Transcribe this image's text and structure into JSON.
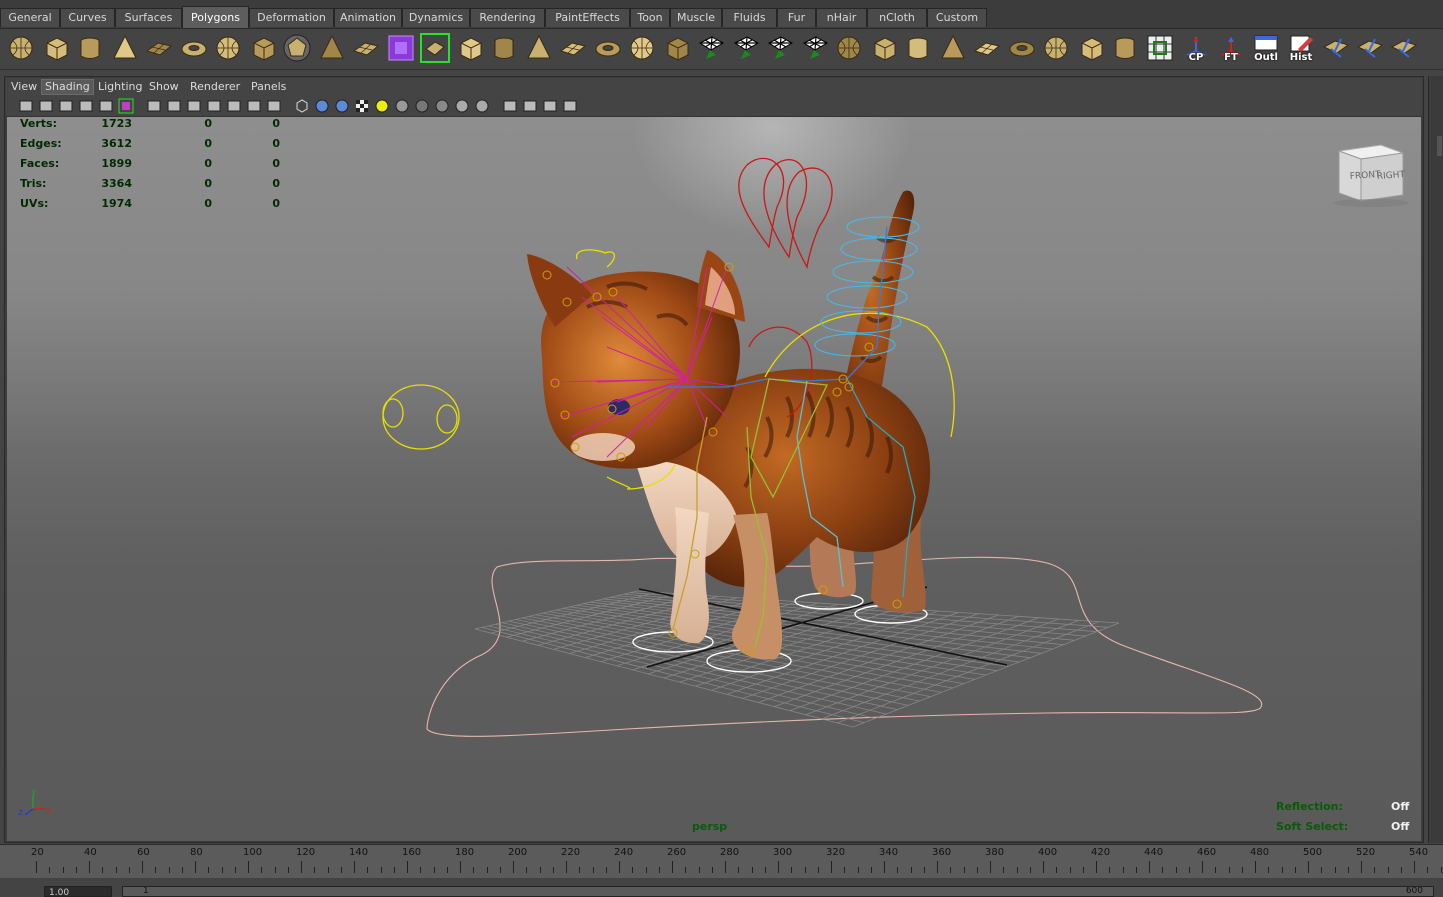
{
  "shelf_tabs": [
    {
      "label": "General",
      "active": false
    },
    {
      "label": "Curves",
      "active": false
    },
    {
      "label": "Surfaces",
      "active": false
    },
    {
      "label": "Polygons",
      "active": true
    },
    {
      "label": "Deformation",
      "active": false
    },
    {
      "label": "Animation",
      "active": false
    },
    {
      "label": "Dynamics",
      "active": false
    },
    {
      "label": "Rendering",
      "active": false
    },
    {
      "label": "PaintEffects",
      "active": false
    },
    {
      "label": "Toon",
      "active": false
    },
    {
      "label": "Muscle",
      "active": false
    },
    {
      "label": "Fluids",
      "active": false
    },
    {
      "label": "Fur",
      "active": false
    },
    {
      "label": "nHair",
      "active": false
    },
    {
      "label": "nCloth",
      "active": false
    },
    {
      "label": "Custom",
      "active": false
    }
  ],
  "shelf_buttons": [
    {
      "icon": "poly-sphere-icon"
    },
    {
      "icon": "poly-cube-icon"
    },
    {
      "icon": "poly-cylinder-icon"
    },
    {
      "icon": "poly-cone-icon"
    },
    {
      "icon": "poly-plane-icon"
    },
    {
      "icon": "poly-torus-icon"
    },
    {
      "icon": "poly-pyramid-icon"
    },
    {
      "icon": "poly-pipe-icon"
    },
    {
      "icon": "poly-platonic-icon"
    },
    {
      "icon": "combine-icon"
    },
    {
      "icon": "separate-icon"
    },
    {
      "icon": "smooth-icon"
    },
    {
      "icon": "extract-icon"
    },
    {
      "icon": "mirror-geometry-icon"
    },
    {
      "icon": "bridge-icon"
    },
    {
      "icon": "append-polygon-icon"
    },
    {
      "icon": "split-polygon-icon"
    },
    {
      "icon": "insert-edge-loop-icon"
    },
    {
      "icon": "extrude-icon"
    },
    {
      "icon": "merge-icon"
    },
    {
      "icon": "fill-hole-icon"
    },
    {
      "icon": "bevel-icon"
    },
    {
      "icon": "collapse-icon"
    },
    {
      "icon": "duplicate-face-icon"
    },
    {
      "icon": "wedge-icon"
    },
    {
      "icon": "poke-icon"
    },
    {
      "icon": "chamfer-icon"
    },
    {
      "icon": "offset-edge-icon"
    },
    {
      "icon": "sculpt-icon"
    },
    {
      "icon": "planar-map-icon"
    },
    {
      "icon": "cylindrical-map-icon"
    },
    {
      "icon": "spherical-map-icon"
    },
    {
      "icon": "automatic-map-icon"
    },
    {
      "icon": "uv-editor-icon"
    }
  ],
  "shelf_text_buttons": [
    {
      "icon": "center-pivot-icon",
      "label": "CP"
    },
    {
      "icon": "freeze-transform-icon",
      "label": "FT"
    },
    {
      "icon": "outliner-icon",
      "label": "Outl"
    },
    {
      "icon": "history-icon",
      "label": "Hist"
    }
  ],
  "shelf_tail_buttons": [
    {
      "icon": "poly-tool-a-icon"
    },
    {
      "icon": "poly-tool-b-icon"
    },
    {
      "icon": "poly-tool-c-icon"
    }
  ],
  "panel_menu": [
    {
      "label": "View",
      "active": false
    },
    {
      "label": "Shading",
      "active": true
    },
    {
      "label": "Lighting",
      "active": false
    },
    {
      "label": "Show",
      "active": false
    },
    {
      "label": "Renderer",
      "active": false
    },
    {
      "label": "Panels",
      "active": false
    }
  ],
  "panel_toolbar": [
    "select-camera-icon",
    "camera-attributes-icon",
    "bookmark-icon",
    "image-plane-icon",
    "two-d-pan-icon",
    "frame-icon",
    "grid-icon",
    "film-gate-icon",
    "resolution-gate-icon",
    "gate-mask-icon",
    "field-chart-icon",
    "safe-action-icon",
    "safe-title-icon",
    "wireframe-icon",
    "smooth-shade-icon",
    "default-material-icon",
    "texture-icon",
    "lights-icon",
    "shadows-icon",
    "screen-space-ao-icon",
    "motion-blur-icon",
    "anti-alias-icon",
    "depth-of-field-icon",
    "isolate-select-icon",
    "xray-icon",
    "xray-joints-icon",
    "xray-components-icon"
  ],
  "poly_count": [
    {
      "label": "Verts:",
      "values": [
        "1723",
        "0",
        "0"
      ]
    },
    {
      "label": "Edges:",
      "values": [
        "3612",
        "0",
        "0"
      ]
    },
    {
      "label": "Faces:",
      "values": [
        "1899",
        "0",
        "0"
      ]
    },
    {
      "label": "Tris:",
      "values": [
        "3364",
        "0",
        "0"
      ]
    },
    {
      "label": "UVs:",
      "values": [
        "1974",
        "0",
        "0"
      ]
    }
  ],
  "viewport": {
    "camera": "persp",
    "view_cube": {
      "front": "FRONT",
      "right": "RIGHT"
    },
    "axis": {
      "x": "x",
      "y": "y",
      "z": "z"
    },
    "reflection_label": "Reflection:",
    "reflection_value": "Off",
    "soft_select_label": "Soft Select:",
    "soft_select_value": "Off"
  },
  "timeline": {
    "ticks": [
      "20",
      "40",
      "60",
      "80",
      "100",
      "120",
      "140",
      "160",
      "180",
      "200",
      "220",
      "240",
      "260",
      "280",
      "300",
      "320",
      "340",
      "360",
      "380",
      "400",
      "420",
      "440",
      "460",
      "480",
      "500",
      "520",
      "540"
    ]
  },
  "range": {
    "start": "1.00",
    "current": "1",
    "end": "600"
  },
  "colors": {
    "hud_green": "#002a00",
    "hud_label_green": "#0a5a0a",
    "shelf_tab_active": "#5d5d5d",
    "viewport_top": "#8e8e8e",
    "viewport_bottom": "#5a5a5a"
  }
}
